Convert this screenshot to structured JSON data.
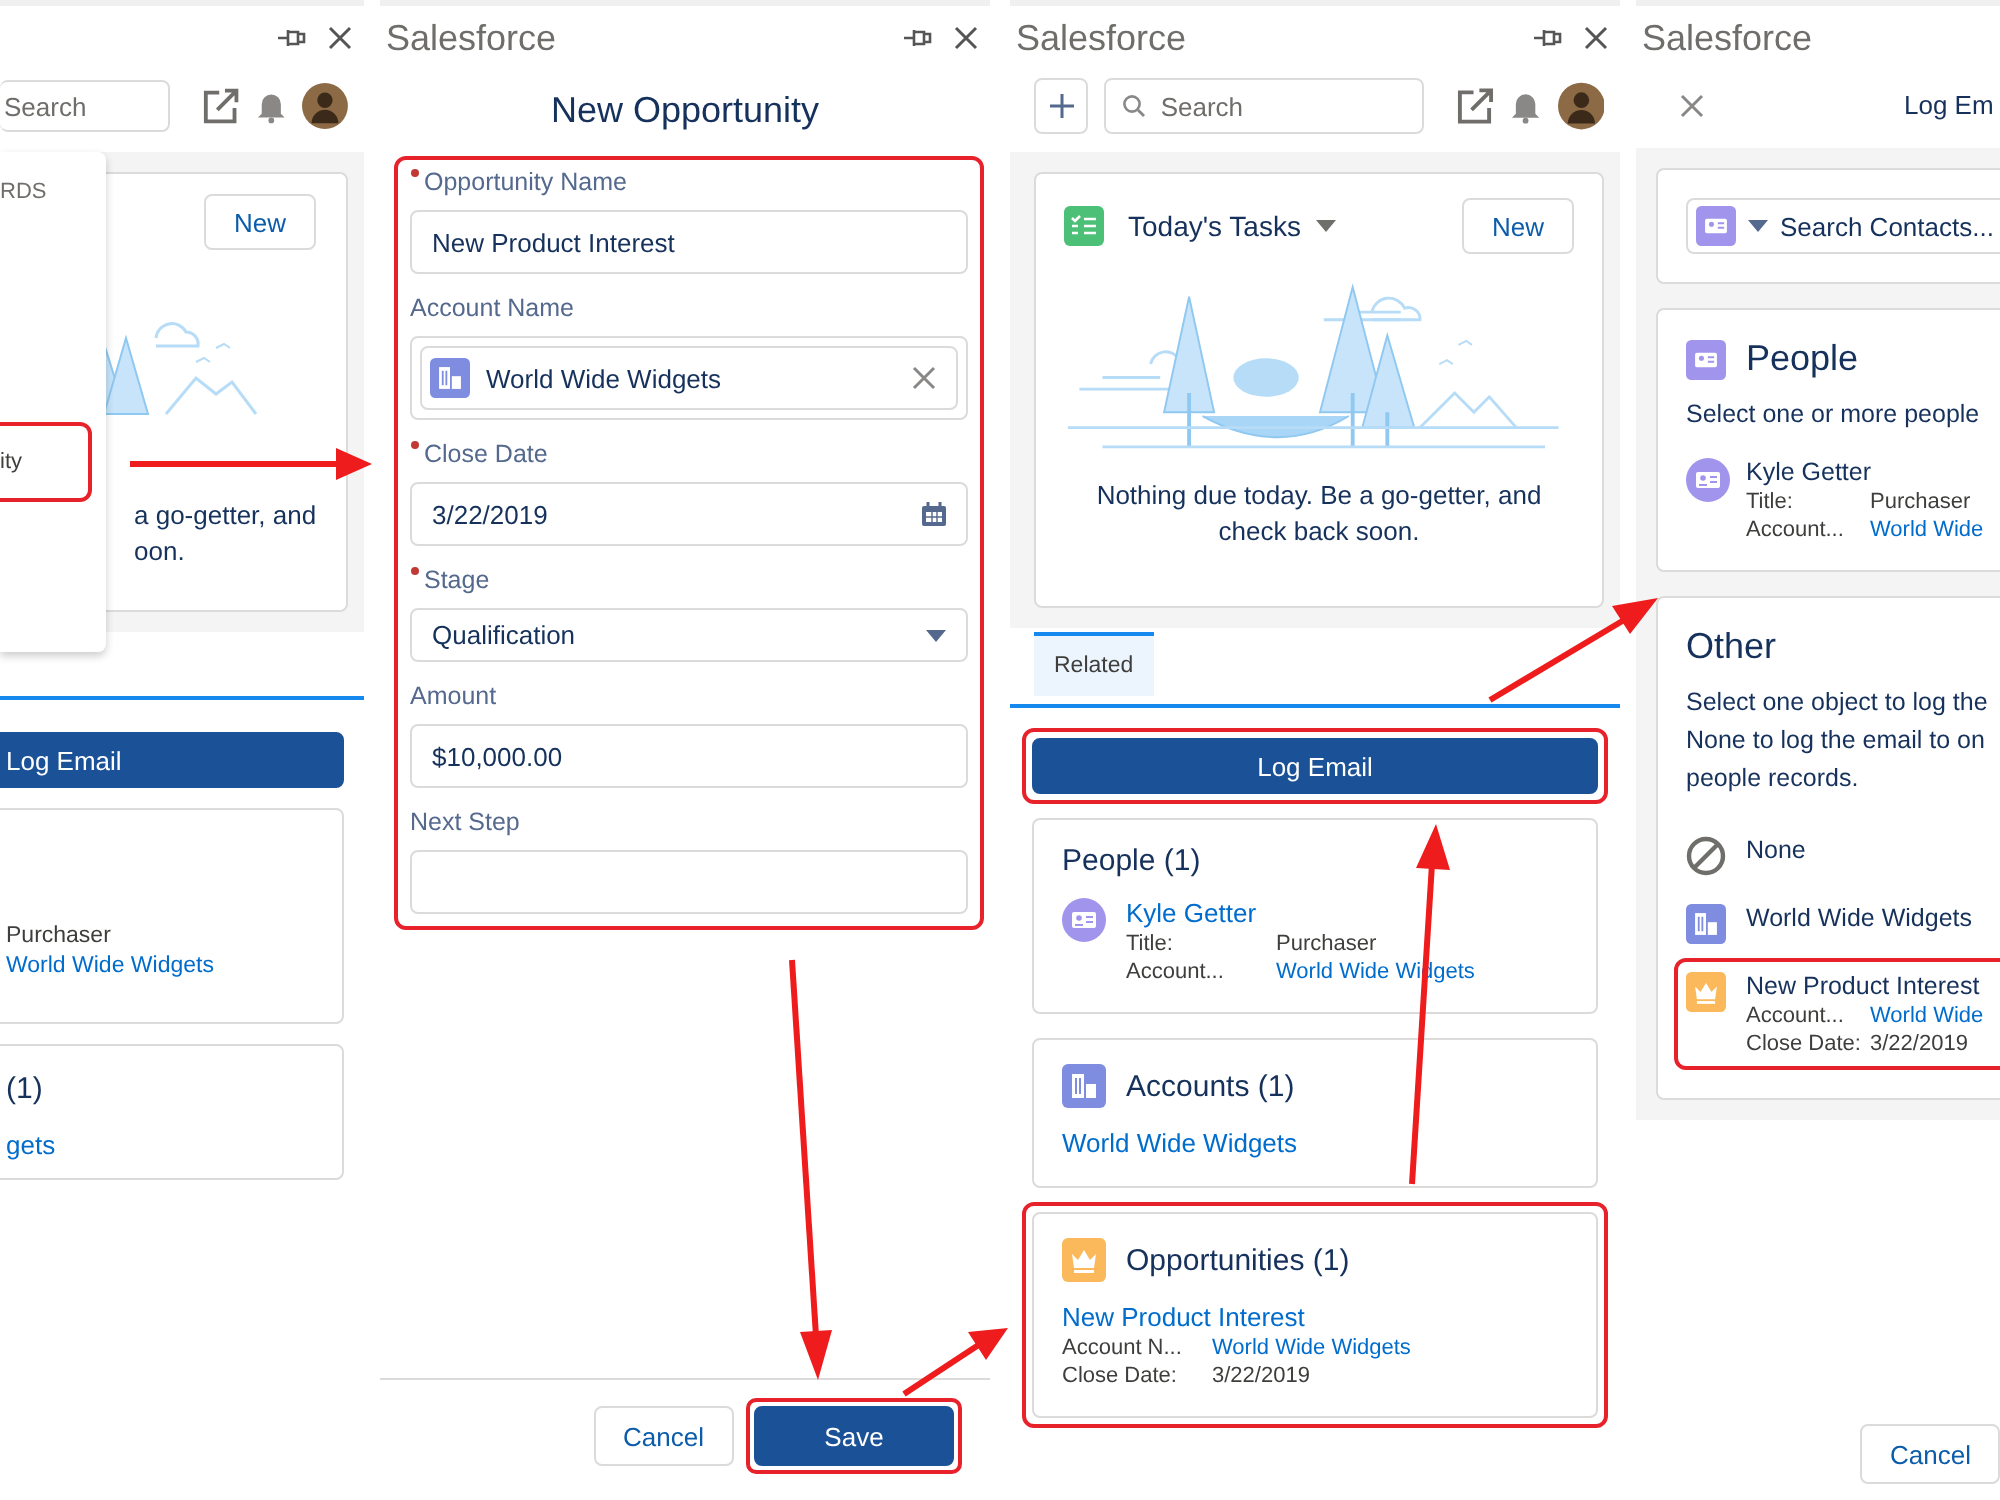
{
  "home_panel_cut": {
    "search": {
      "placeholder": "Search"
    },
    "menu": {
      "heading": "RDS",
      "items": [
        {
          "label": "ity",
          "highlighted": true
        }
      ]
    },
    "tasks_card": {
      "new_button": "New",
      "message_lines": [
        "a go-getter, and",
        "oon."
      ]
    },
    "log_email_button": "Log Email",
    "people_card": {
      "title_value": "Purchaser",
      "account_link": "World Wide Widgets"
    },
    "accounts_card": {
      "title": "(1)",
      "link": "gets"
    }
  },
  "new_opportunity_panel": {
    "app_title": "Salesforce",
    "heading": "New Opportunity",
    "form_highlighted": true,
    "fields": [
      {
        "kind": "text",
        "label": "Opportunity Name",
        "required": true,
        "value": "New Product Interest"
      },
      {
        "kind": "lookup",
        "label": "Account Name",
        "required": false,
        "value": "World Wide Widgets"
      },
      {
        "kind": "date",
        "label": "Close Date",
        "required": true,
        "value": "3/22/2019"
      },
      {
        "kind": "picklist",
        "label": "Stage",
        "required": true,
        "value": "Qualification"
      },
      {
        "kind": "text",
        "label": "Amount",
        "required": false,
        "value": "$10,000.00"
      },
      {
        "kind": "text",
        "label": "Next Step",
        "required": false
      }
    ],
    "buttons": [
      {
        "label": "Cancel",
        "kind": "neutral",
        "highlighted": false
      },
      {
        "label": "Save",
        "kind": "brand",
        "highlighted": true
      }
    ]
  },
  "home_panel": {
    "app_title": "Salesforce",
    "search": {
      "placeholder": "Search"
    },
    "tasks_card": {
      "title": "Today's Tasks",
      "new_button": "New",
      "message": "Nothing due today. Be a go-getter, and check back soon."
    },
    "tabs": [
      {
        "label": "Related",
        "selected": true
      }
    ],
    "log_email_button": {
      "label": "Log Email",
      "highlighted": true
    },
    "related_lists": [
      {
        "kind": "people",
        "title": "People (1)",
        "highlighted": false,
        "records": [
          {
            "name": "Kyle Getter",
            "fields": [
              {
                "label": "Title:",
                "value": "Purchaser",
                "link": false
              },
              {
                "label": "Account...",
                "value": "World Wide Widgets",
                "link": true
              }
            ]
          }
        ]
      },
      {
        "kind": "accounts",
        "title": "Accounts (1)",
        "highlighted": false,
        "records": [
          {
            "name": "World Wide Widgets"
          }
        ]
      },
      {
        "kind": "opportunities",
        "title": "Opportunities (1)",
        "highlighted": true,
        "records": [
          {
            "name": "New Product Interest",
            "fields": [
              {
                "label": "Account N...",
                "value": "World Wide Widgets",
                "link": true
              },
              {
                "label": "Close Date:",
                "value": "3/22/2019",
                "link": false
              }
            ]
          }
        ]
      }
    ]
  },
  "log_email_panel": {
    "app_title": "Salesforce",
    "heading": "Log Em",
    "search": {
      "placeholder": "Search Contacts..."
    },
    "people_section": {
      "title": "People",
      "description": "Select one or more people",
      "records": [
        {
          "name": "Kyle Getter",
          "fields": [
            {
              "label": "Title:",
              "value": "Purchaser",
              "link": false
            },
            {
              "label": "Account...",
              "value": "World Wide",
              "link": true
            }
          ]
        }
      ]
    },
    "other_section": {
      "title": "Other",
      "description_lines": [
        "Select one object to log the",
        "None to log the email to on",
        "people records."
      ],
      "options": [
        {
          "kind": "none",
          "name": "None",
          "highlighted": false
        },
        {
          "kind": "account",
          "name": "World Wide Widgets",
          "highlighted": false
        },
        {
          "kind": "opportunity",
          "name": "New Product Interest",
          "highlighted": true,
          "fields": [
            {
              "label": "Account...",
              "value": "World Wide",
              "link": true
            },
            {
              "label": "Close Date:",
              "value": "3/22/2019",
              "link": false
            }
          ]
        }
      ]
    },
    "buttons": [
      {
        "label": "Cancel"
      }
    ]
  }
}
